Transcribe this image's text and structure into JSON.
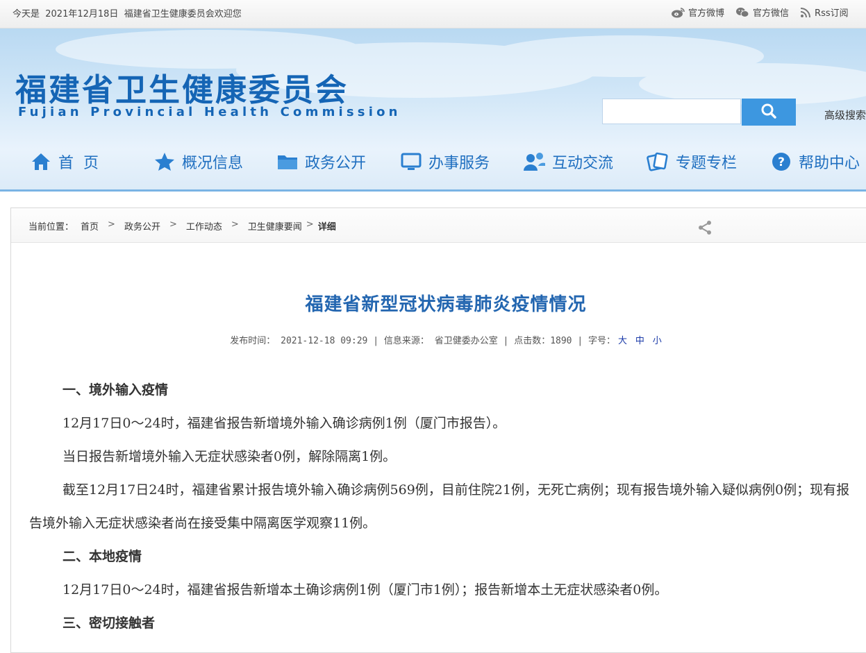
{
  "topbar": {
    "greeting": "今天是  2021年12月18日  福建省卫生健康委员会欢迎您",
    "weibo": "官方微博",
    "wechat": "官方微信",
    "rss": "Rss订阅"
  },
  "header": {
    "logo_cn": "福建省卫生健康委员会",
    "logo_en": "Fujian Provincial Health Commission",
    "search_placeholder": "",
    "advanced_search": "高级搜索"
  },
  "nav": [
    {
      "label": "首  页",
      "icon": "home-icon"
    },
    {
      "label": "概况信息",
      "icon": "star-icon"
    },
    {
      "label": "政务公开",
      "icon": "folder-icon"
    },
    {
      "label": "办事服务",
      "icon": "monitor-icon"
    },
    {
      "label": "互动交流",
      "icon": "people-icon"
    },
    {
      "label": "专题专栏",
      "icon": "topics-icon"
    },
    {
      "label": "帮助中心",
      "icon": "help-icon"
    }
  ],
  "breadcrumb": {
    "prefix": "当前位置：",
    "items": [
      "首页",
      "政务公开",
      "工作动态",
      "卫生健康要闻",
      "详细"
    ]
  },
  "article": {
    "title": "福建省新型冠状病毒肺炎疫情情况",
    "meta_time_label": "发布时间：",
    "meta_time": "2021-12-18 09:29",
    "meta_source_label": "信息来源：",
    "meta_source": "省卫健委办公室",
    "meta_clicks_label": "点击数：",
    "meta_clicks": "1890",
    "meta_font_label": "字号：",
    "font_large": "大",
    "font_medium": "中",
    "font_small": "小",
    "paragraphs": [
      "一、境外输入疫情",
      "12月17日0～24时，福建省报告新增境外输入确诊病例1例（厦门市报告）。",
      "当日报告新增境外输入无症状感染者0例，解除隔离1例。",
      "截至12月17日24时，福建省累计报告境外输入确诊病例569例，目前住院21例，无死亡病例；现有报告境外输入疑似病例0例；现有报告境外输入无症状感染者尚在接受集中隔离医学观察11例。",
      "二、本地疫情",
      "12月17日0～24时，福建省报告新增本土确诊病例1例（厦门市1例）；报告新增本土无症状感染者0例。",
      "三、密切接触者"
    ]
  },
  "colors": {
    "brand_blue": "#1565b5",
    "title_blue": "#2366b0",
    "search_blue": "#3d97e0"
  }
}
